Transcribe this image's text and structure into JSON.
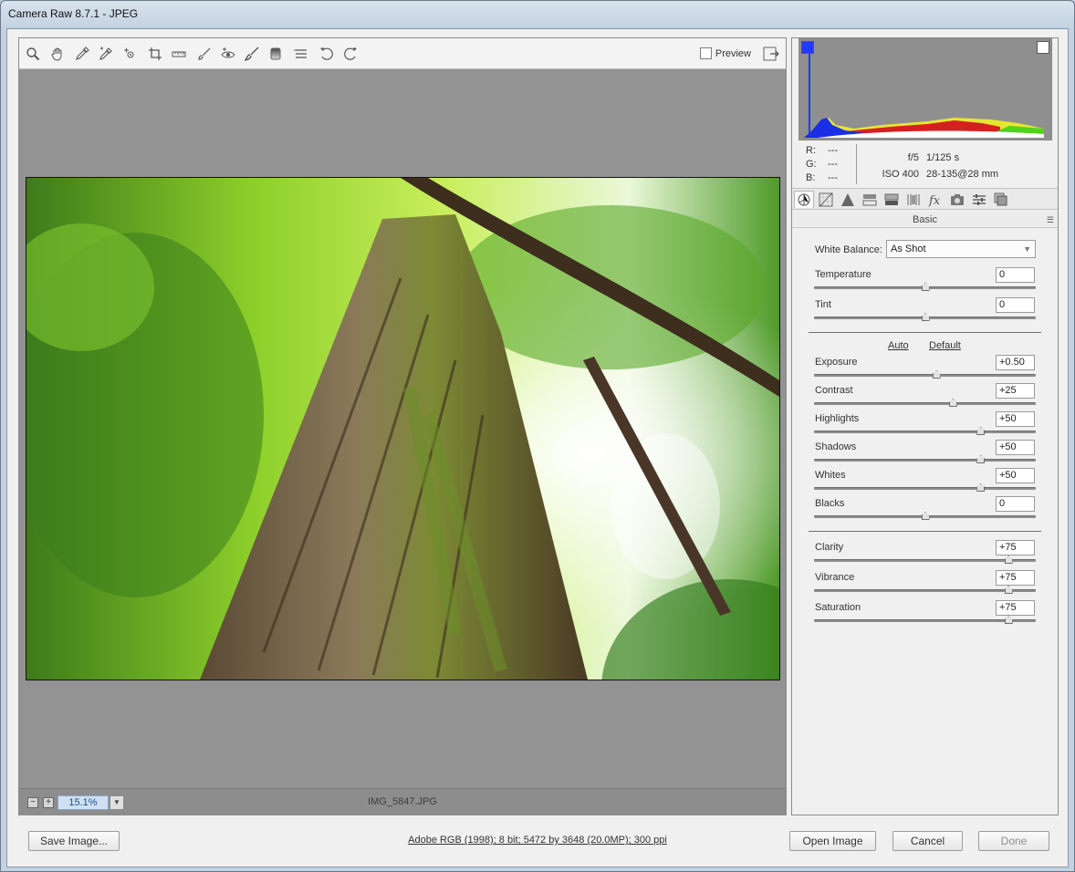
{
  "window": {
    "title": "Camera Raw 8.7.1  -  JPEG"
  },
  "toolbar": {
    "tools": [
      "zoom-tool-icon",
      "hand-tool-icon",
      "white-balance-tool-icon",
      "color-sampler-tool-icon",
      "targeted-adjustment-tool-icon",
      "crop-tool-icon",
      "straighten-tool-icon",
      "spot-removal-tool-icon",
      "red-eye-removal-tool-icon",
      "adjustment-brush-icon",
      "graduated-filter-icon",
      "radial-filter-icon",
      "preferences-icon",
      "rotate-left-icon",
      "rotate-right-icon"
    ],
    "preview_label": "Preview"
  },
  "statusbar": {
    "zoom_out": "−",
    "zoom_in": "+",
    "zoom_value": "15.1%",
    "filename": "IMG_5847.JPG"
  },
  "readout": {
    "r_label": "R:",
    "r_value": "---",
    "g_label": "G:",
    "g_value": "---",
    "b_label": "B:",
    "b_value": "---",
    "aperture": "f/5",
    "shutter": "1/125 s",
    "iso": "ISO 400",
    "lens": "28-135@28 mm"
  },
  "panel": {
    "title": "Basic",
    "white_balance_label": "White Balance:",
    "white_balance_value": "As Shot",
    "auto": "Auto",
    "default": "Default",
    "sliders": [
      {
        "label": "Temperature",
        "value": "0",
        "pos": 0.5
      },
      {
        "label": "Tint",
        "value": "0",
        "pos": 0.5
      },
      {
        "label": "Exposure",
        "value": "+0.50",
        "pos": 0.55
      },
      {
        "label": "Contrast",
        "value": "+25",
        "pos": 0.625
      },
      {
        "label": "Highlights",
        "value": "+50",
        "pos": 0.75
      },
      {
        "label": "Shadows",
        "value": "+50",
        "pos": 0.75
      },
      {
        "label": "Whites",
        "value": "+50",
        "pos": 0.75
      },
      {
        "label": "Blacks",
        "value": "0",
        "pos": 0.5
      },
      {
        "label": "Clarity",
        "value": "+75",
        "pos": 0.875
      },
      {
        "label": "Vibrance",
        "value": "+75",
        "pos": 0.875
      },
      {
        "label": "Saturation",
        "value": "+75",
        "pos": 0.875
      }
    ]
  },
  "footer": {
    "save": "Save Image...",
    "info": "Adobe RGB (1998); 8 bit; 5472 by 3648 (20.0MP); 300 ppi",
    "open": "Open Image",
    "cancel": "Cancel",
    "done": "Done"
  }
}
